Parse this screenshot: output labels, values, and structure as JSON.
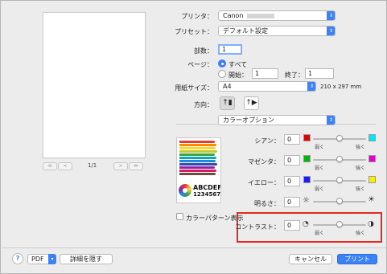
{
  "printer": {
    "label": "プリンタ：",
    "value": "Canon"
  },
  "preset": {
    "label": "プリセット：",
    "value": "デフォルト設定"
  },
  "copies": {
    "label": "部数：",
    "value": "1"
  },
  "pages": {
    "label": "ページ：",
    "all_label": "すべて",
    "from_label": "開始：",
    "from_value": "1",
    "to_label": "終了：",
    "to_value": "1"
  },
  "paper_size": {
    "label": "用紙サイズ：",
    "value": "A4",
    "dimensions": "210 x 297 mm"
  },
  "orientation": {
    "label": "方向："
  },
  "section": {
    "value": "カラーオプション"
  },
  "preview": {
    "page_count": "1/1"
  },
  "adjust": {
    "cyan": {
      "label": "シアン：",
      "value": "0",
      "weak": "弱く",
      "strong": "強く"
    },
    "magenta": {
      "label": "マゼンタ：",
      "value": "0",
      "weak": "弱く",
      "strong": "強く"
    },
    "yellow": {
      "label": "イエロー：",
      "value": "0",
      "weak": "弱く",
      "strong": "強く"
    },
    "brightness": {
      "label": "明るさ：",
      "value": "0"
    },
    "contrast": {
      "label": "コントラスト：",
      "value": "0",
      "weak": "弱く",
      "strong": "強く"
    }
  },
  "thumbnail": {
    "text1": "ABCDEF",
    "text2": "1234567"
  },
  "color_pattern": {
    "label": "カラーパターン表示"
  },
  "bottom": {
    "help": "?",
    "pdf": "PDF",
    "details": "詳細を隠す",
    "cancel": "キャンセル",
    "print": "プリント"
  },
  "colors": {
    "accent": "#3b82f6",
    "highlight": "#e32a20",
    "cyan": "#00e5ff",
    "magenta": "#e000c8",
    "yellow": "#ffee00",
    "red": "#e00000",
    "green": "#00b800",
    "blue": "#1a1aff"
  }
}
